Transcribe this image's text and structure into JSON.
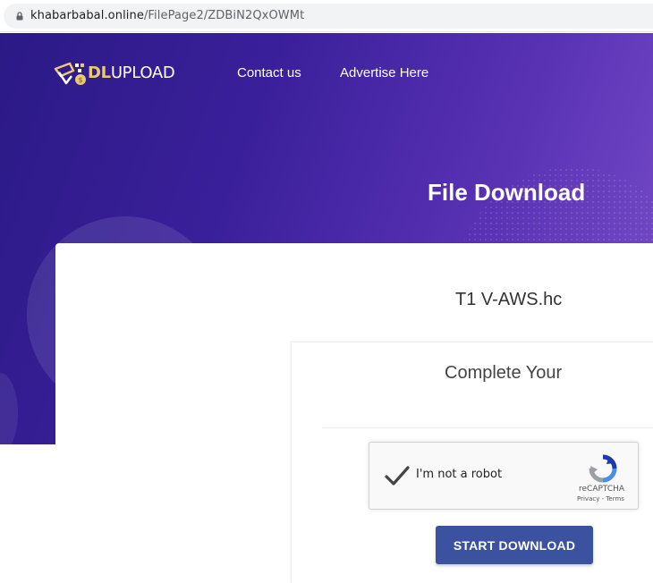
{
  "browser": {
    "url_host": "khabarbabal.online",
    "url_path": "/FilePage2/ZDBiN2QxOWMt",
    "icons": {
      "lock": "lock-icon"
    }
  },
  "header": {
    "logo": {
      "accent": "DL",
      "rest": "UPLOAD",
      "colors": {
        "accent": "#e9c878",
        "text": "#ffffff"
      }
    },
    "nav": [
      {
        "label": "Contact us"
      },
      {
        "label": "Advertise Here"
      }
    ],
    "title": "File Download"
  },
  "main": {
    "file_name": "T1 V-AWS.hc",
    "panel_title": "Complete Your",
    "captcha": {
      "label": "I'm not a robot",
      "brand": "reCAPTCHA",
      "privacy": "Privacy",
      "separator": " - ",
      "terms": "Terms",
      "checked": true
    },
    "download_button": "START DOWNLOAD"
  },
  "colors": {
    "hero_start": "#2b1a86",
    "hero_end": "#7a4fca",
    "button": "#3a52a0"
  }
}
